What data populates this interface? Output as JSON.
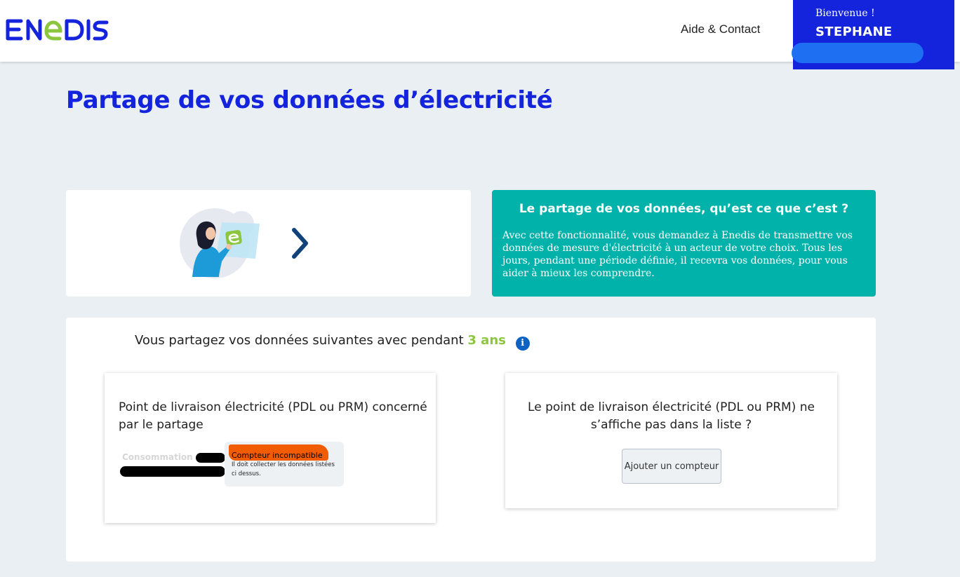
{
  "header": {
    "logo_text": "ENEDIS",
    "nav_link": "Aide & Contact",
    "welcome_greeting": "Bienvenue !",
    "welcome_name": "STEPHANE",
    "colors": {
      "brand_blue": "#1423dc",
      "logo_green": "#8cc63f",
      "redaction": "#1f6ff2"
    }
  },
  "page": {
    "title": "Partage de vos données d’électricité"
  },
  "illustration": {
    "icon": "woman-holding-tablet-illustration",
    "next_icon": "chevron-right-icon"
  },
  "info_card": {
    "title": "Le partage de vos données, qu’est ce que c’est ?",
    "text": "Avec cette fonctionnalité, vous demandez à Enedis de transmettre vos données de mesure d'électricité à un acteur de votre choix. Tous les jours, pendant une période définie, il recevra vos données, pour vous aider à mieux les comprendre.",
    "color": "#00b2a9"
  },
  "share": {
    "sentence": "Vous partagez vos données suivantes avec pendant",
    "duration": "3 ans",
    "info_icon": "i",
    "pdl_card": {
      "title": "Point de livraison électricité (PDL ou PRM) concerné par le partage",
      "meter_label": "Consommation -",
      "status_title": "Compteur incompatible",
      "status_text": "Il doit collecter les données listées ci dessus.",
      "status_color": "#f25c00"
    },
    "add_card": {
      "title": "Le point de livraison électricité (PDL ou PRM) ne s’affiche pas dans la liste ?",
      "button_label": "Ajouter un compteur"
    }
  }
}
